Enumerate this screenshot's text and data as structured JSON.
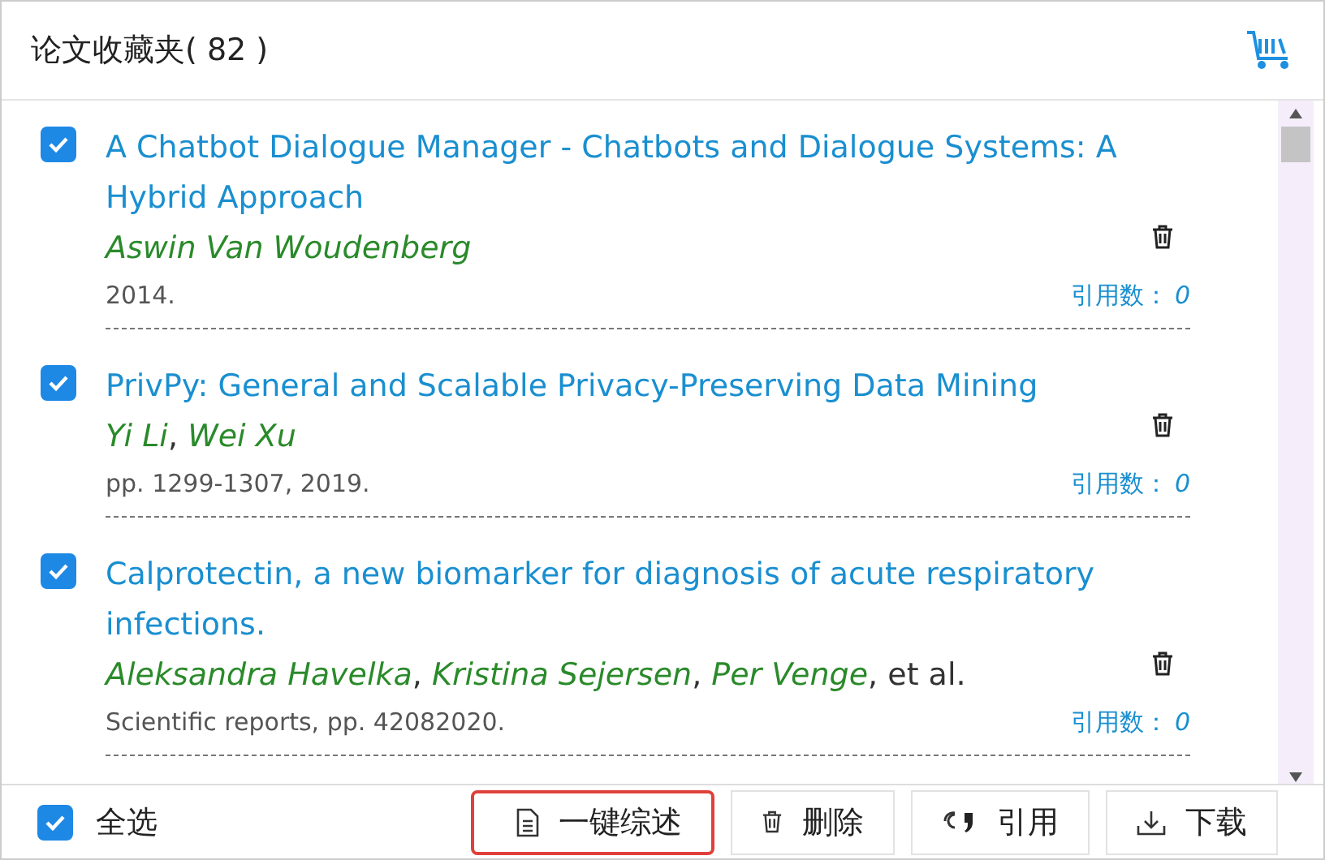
{
  "header": {
    "title": "论文收藏夹( 82 )"
  },
  "author_separator": ", ",
  "papers": [
    {
      "checked": true,
      "title": "A Chatbot Dialogue Manager - Chatbots and Dialogue Systems: A Hybrid Approach",
      "authors": [
        "Aswin Van Woudenberg"
      ],
      "source": "2014.",
      "cite_label": "引用数：",
      "cite_count": "0"
    },
    {
      "checked": true,
      "title": "PrivPy: General and Scalable Privacy-Preserving Data Mining",
      "authors": [
        "Yi Li",
        "Wei Xu"
      ],
      "source": "pp. 1299-1307, 2019.",
      "cite_label": "引用数：",
      "cite_count": "0"
    },
    {
      "checked": true,
      "title": "Calprotectin, a new biomarker for diagnosis of acute respiratory infections.",
      "authors": [
        "Aleksandra Havelka",
        "Kristina Sejersen",
        "Per Venge"
      ],
      "suffix": "et al.",
      "source": "Scientific reports, pp. 42082020.",
      "cite_label": "引用数：",
      "cite_count": "0"
    }
  ],
  "footer": {
    "select_all": {
      "label": "全选",
      "checked": true
    },
    "buttons": [
      {
        "kind": "review",
        "label": "一键综述",
        "highlighted": true
      },
      {
        "kind": "delete",
        "label": "删除",
        "highlighted": false
      },
      {
        "kind": "cite",
        "label": "引用",
        "highlighted": false
      },
      {
        "kind": "download",
        "label": "下载",
        "highlighted": false
      }
    ]
  }
}
